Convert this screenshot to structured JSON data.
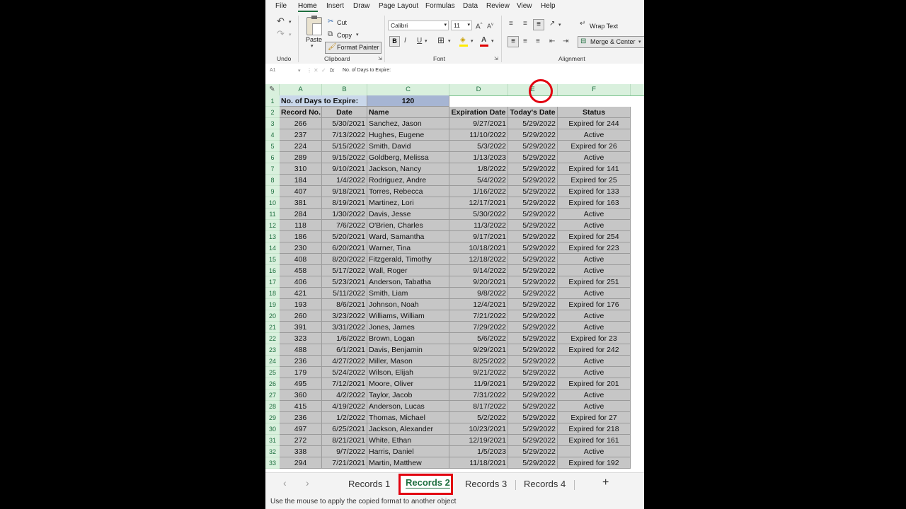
{
  "menu": [
    "File",
    "Home",
    "Insert",
    "Draw",
    "Page Layout",
    "Formulas",
    "Data",
    "Review",
    "View",
    "Help"
  ],
  "ribbon": {
    "paste": "Paste",
    "cut": "Cut",
    "copy": "Copy",
    "format_painter": "Format Painter",
    "font_name": "Calibri",
    "font_size": "11",
    "wrap_text": "Wrap Text",
    "merge_center": "Merge & Center",
    "groups": {
      "undo": "Undo",
      "clipboard": "Clipboard",
      "font": "Font",
      "alignment": "Alignment"
    }
  },
  "formula_bar": {
    "name_box": "A1",
    "fx": "fx",
    "content": "No. of Days to Expire:"
  },
  "columns": [
    "A",
    "B",
    "C",
    "D",
    "E",
    "F"
  ],
  "sheet": {
    "row1": {
      "label": "No. of Days to Expire:",
      "value": "120"
    },
    "headers": [
      "Record No.",
      "Date",
      "Name",
      "Expiration Date",
      "Today's Date",
      "Status"
    ],
    "rows": [
      [
        "266",
        "5/30/2021",
        "Sanchez, Jason",
        "9/27/2021",
        "5/29/2022",
        "Expired for 244"
      ],
      [
        "237",
        "7/13/2022",
        "Hughes, Eugene",
        "11/10/2022",
        "5/29/2022",
        "Active"
      ],
      [
        "224",
        "5/15/2022",
        "Smith, David",
        "5/3/2022",
        "5/29/2022",
        "Expired for 26"
      ],
      [
        "289",
        "9/15/2022",
        "Goldberg, Melissa",
        "1/13/2023",
        "5/29/2022",
        "Active"
      ],
      [
        "310",
        "9/10/2021",
        "Jackson, Nancy",
        "1/8/2022",
        "5/29/2022",
        "Expired for 141"
      ],
      [
        "184",
        "1/4/2022",
        "Rodriguez, Andre",
        "5/4/2022",
        "5/29/2022",
        "Expired for 25"
      ],
      [
        "407",
        "9/18/2021",
        "Torres, Rebecca",
        "1/16/2022",
        "5/29/2022",
        "Expired for 133"
      ],
      [
        "381",
        "8/19/2021",
        "Martinez, Lori",
        "12/17/2021",
        "5/29/2022",
        "Expired for 163"
      ],
      [
        "284",
        "1/30/2022",
        "Davis, Jesse",
        "5/30/2022",
        "5/29/2022",
        "Active"
      ],
      [
        "118",
        "7/6/2022",
        "O'Brien, Charles",
        "11/3/2022",
        "5/29/2022",
        "Active"
      ],
      [
        "186",
        "5/20/2021",
        "Ward, Samantha",
        "9/17/2021",
        "5/29/2022",
        "Expired for 254"
      ],
      [
        "230",
        "6/20/2021",
        "Warner, Tina",
        "10/18/2021",
        "5/29/2022",
        "Expired for 223"
      ],
      [
        "408",
        "8/20/2022",
        "Fitzgerald, Timothy",
        "12/18/2022",
        "5/29/2022",
        "Active"
      ],
      [
        "458",
        "5/17/2022",
        "Wall, Roger",
        "9/14/2022",
        "5/29/2022",
        "Active"
      ],
      [
        "406",
        "5/23/2021",
        "Anderson, Tabatha",
        "9/20/2021",
        "5/29/2022",
        "Expired for 251"
      ],
      [
        "421",
        "5/11/2022",
        "Smith, Liam",
        "9/8/2022",
        "5/29/2022",
        "Active"
      ],
      [
        "193",
        "8/6/2021",
        "Johnson, Noah",
        "12/4/2021",
        "5/29/2022",
        "Expired for 176"
      ],
      [
        "260",
        "3/23/2022",
        "Williams, William",
        "7/21/2022",
        "5/29/2022",
        "Active"
      ],
      [
        "391",
        "3/31/2022",
        "Jones, James",
        "7/29/2022",
        "5/29/2022",
        "Active"
      ],
      [
        "323",
        "1/6/2022",
        "Brown, Logan",
        "5/6/2022",
        "5/29/2022",
        "Expired for 23"
      ],
      [
        "488",
        "6/1/2021",
        "Davis, Benjamin",
        "9/29/2021",
        "5/29/2022",
        "Expired for 242"
      ],
      [
        "236",
        "4/27/2022",
        "Miller, Mason",
        "8/25/2022",
        "5/29/2022",
        "Active"
      ],
      [
        "179",
        "5/24/2022",
        "Wilson, Elijah",
        "9/21/2022",
        "5/29/2022",
        "Active"
      ],
      [
        "495",
        "7/12/2021",
        "Moore, Oliver",
        "11/9/2021",
        "5/29/2022",
        "Expired for 201"
      ],
      [
        "360",
        "4/2/2022",
        "Taylor, Jacob",
        "7/31/2022",
        "5/29/2022",
        "Active"
      ],
      [
        "415",
        "4/19/2022",
        "Anderson, Lucas",
        "8/17/2022",
        "5/29/2022",
        "Active"
      ],
      [
        "236",
        "1/2/2022",
        "Thomas, Michael",
        "5/2/2022",
        "5/29/2022",
        "Expired for 27"
      ],
      [
        "497",
        "6/25/2021",
        "Jackson, Alexander",
        "10/23/2021",
        "5/29/2022",
        "Expired for 218"
      ],
      [
        "272",
        "8/21/2021",
        "White, Ethan",
        "12/19/2021",
        "5/29/2022",
        "Expired for 161"
      ],
      [
        "338",
        "9/7/2022",
        "Harris, Daniel",
        "1/5/2023",
        "5/29/2022",
        "Active"
      ],
      [
        "294",
        "7/21/2021",
        "Martin, Matthew",
        "11/18/2021",
        "5/29/2022",
        "Expired for 192"
      ]
    ]
  },
  "tabs": [
    "Records 1",
    "Records 2",
    "Records 3",
    "Records 4"
  ],
  "active_tab": "Records 2",
  "status_text": "Use the mouse to apply the copied format to another object"
}
